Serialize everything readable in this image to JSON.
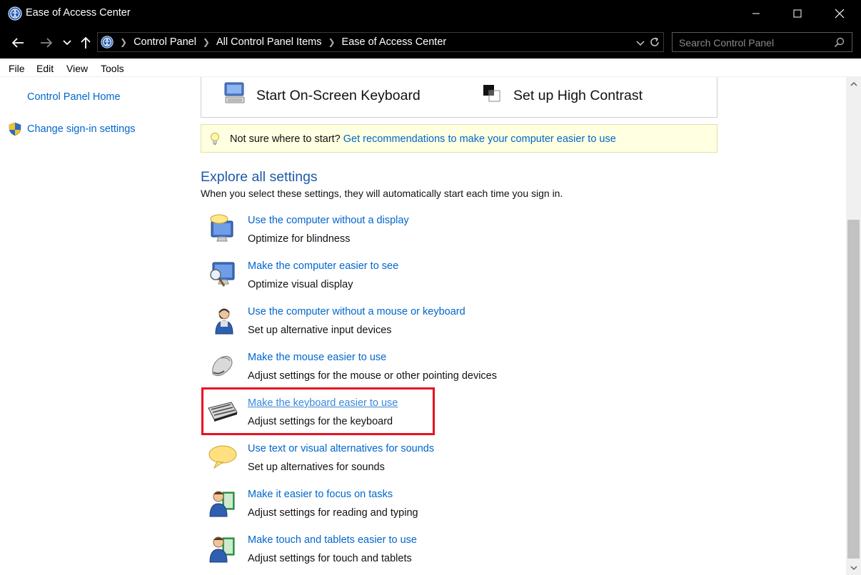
{
  "window": {
    "title": "Ease of Access Center"
  },
  "address_bar": {
    "breadcrumbs": [
      "Control Panel",
      "All Control Panel Items",
      "Ease of Access Center"
    ]
  },
  "search": {
    "placeholder": "Search Control Panel"
  },
  "menu": {
    "items": [
      "File",
      "Edit",
      "View",
      "Tools"
    ]
  },
  "left_nav": {
    "home": "Control Panel Home",
    "signin": "Change sign-in settings"
  },
  "quick_options": {
    "keyboard": "Start On-Screen Keyboard",
    "contrast": "Set up High Contrast"
  },
  "tip": {
    "prefix": "Not sure where to start?",
    "link": "Get recommendations to make your computer easier to use"
  },
  "explore": {
    "heading": "Explore all settings",
    "subtitle": "When you select these settings, they will automatically start each time you sign in."
  },
  "settings": [
    {
      "link": "Use the computer without a display",
      "desc": "Optimize for blindness",
      "icon": "monitor-speech-icon"
    },
    {
      "link": "Make the computer easier to see",
      "desc": "Optimize visual display",
      "icon": "monitor-magnifier-icon"
    },
    {
      "link": "Use the computer without a mouse or keyboard",
      "desc": "Set up alternative input devices",
      "icon": "headset-person-icon"
    },
    {
      "link": "Make the mouse easier to use",
      "desc": "Adjust settings for the mouse or other pointing devices",
      "icon": "mouse-icon"
    },
    {
      "link": "Make the keyboard easier to use",
      "desc": "Adjust settings for the keyboard",
      "icon": "keyboard-icon"
    },
    {
      "link": "Use text or visual alternatives for sounds",
      "desc": "Set up alternatives for sounds",
      "icon": "speech-bubble-icon"
    },
    {
      "link": "Make it easier to focus on tasks",
      "desc": "Adjust settings for reading and typing",
      "icon": "person-book-icon"
    },
    {
      "link": "Make touch and tablets easier to use",
      "desc": "Adjust settings for touch and tablets",
      "icon": "person-tablet-icon"
    }
  ],
  "highlight": {
    "color": "#e81123"
  }
}
